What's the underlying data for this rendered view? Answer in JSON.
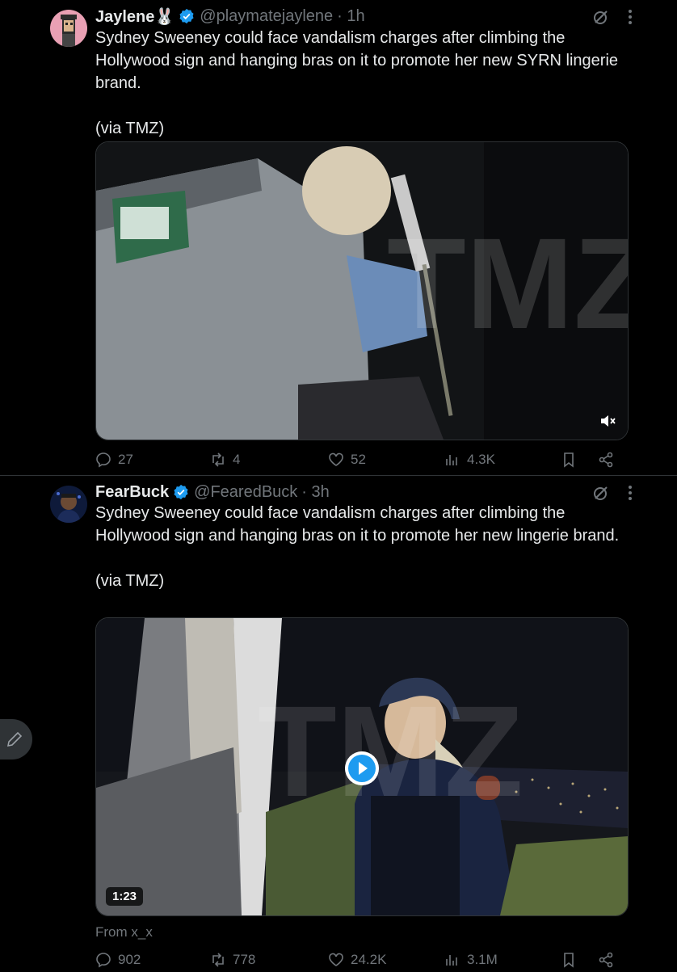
{
  "tweets": [
    {
      "name": "Jaylene🐰",
      "handle": "@playmatejaylene",
      "time": "· 1h",
      "text_lines": [
        "Sydney Sweeney could face vandalism charges after climbing the Hollywood sign and hanging bras on it to promote her new SYRN lingerie brand.",
        "(via TMZ)"
      ],
      "media": {
        "type": "video",
        "watermark": "TMZ",
        "muted_icon": "volume-mute-icon"
      },
      "stats": {
        "replies": "27",
        "reposts": "4",
        "likes": "52",
        "views": "4.3K"
      }
    },
    {
      "name": "FearBuck",
      "handle": "@FearedBuck",
      "time": "· 3h",
      "text_lines": [
        "Sydney Sweeney could face vandalism charges after climbing the Hollywood sign and hanging bras on it to promote her new lingerie brand.",
        "(via TMZ)"
      ],
      "media": {
        "type": "video",
        "watermark": "TMZ",
        "duration": "1:23"
      },
      "from": "From x_x",
      "stats": {
        "replies": "902",
        "reposts": "778",
        "likes": "24.2K",
        "views": "3.1M"
      }
    }
  ],
  "colors": {
    "background": "#000000",
    "text": "#e7e9ea",
    "muted": "#71767b",
    "verified": "#1d9bf0",
    "divider": "#2f3336"
  },
  "icons": [
    "verified-badge-icon",
    "grok-icon",
    "more-icon",
    "reply-icon",
    "repost-icon",
    "like-icon",
    "views-icon",
    "bookmark-icon",
    "share-icon",
    "play-icon",
    "compose-icon"
  ]
}
